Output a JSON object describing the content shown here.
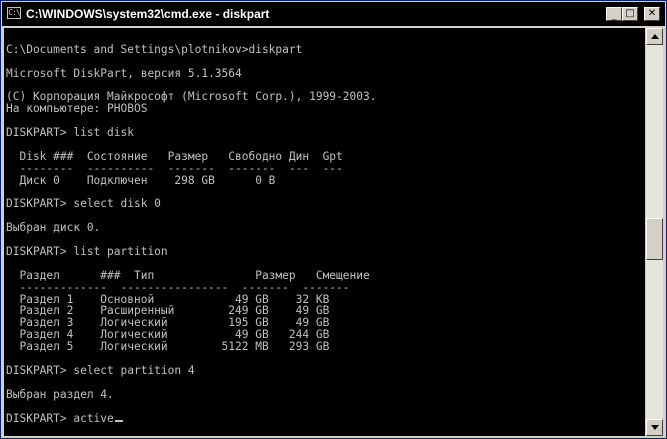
{
  "window": {
    "title": "C:\\WINDOWS\\system32\\cmd.exe - diskpart",
    "icon_label": "C:\\",
    "buttons": {
      "minimize": "_",
      "maximize": "□",
      "close": "✕"
    }
  },
  "console": {
    "lines": [
      "",
      "C:\\Documents and Settings\\plotnikov>diskpart",
      "",
      "Microsoft DiskPart, версия 5.1.3564",
      "",
      "(C) Корпорация Майкрософт (Microsoft Corp.), 1999-2003.",
      "На компьютере: PHOBOS",
      "",
      "DISKPART> list disk",
      "",
      "  Disk ###  Состояние   Размер   Свободно Дин  Gpt",
      "  --------  ----------  -------  -------  ---  ---",
      "  Диск 0    Подключен    298 GB      0 B",
      "",
      "DISKPART> select disk 0",
      "",
      "Выбран диск 0.",
      "",
      "DISKPART> list partition",
      "",
      "  Раздел      ###  Тип               Размер   Смещение",
      "  -------------  ----------------  -------  -------",
      "  Раздел 1    Основной            49 GB    32 KB",
      "  Раздел 2    Расширенный        249 GB    49 GB",
      "  Раздел 3    Логический         195 GB    49 GB",
      "  Раздел 4    Логический          49 GB   244 GB",
      "  Раздел 5    Логический        5122 MB   293 GB",
      "",
      "DISKPART> select partition 4",
      "",
      "Выбран раздел 4.",
      "",
      "DISKPART> active"
    ]
  },
  "colors": {
    "console_bg": "#000000",
    "console_text": "#c0c0c0",
    "titlebar_bg": "#000000",
    "chrome": "#d4d0c8"
  },
  "icons": {
    "app": "console-icon",
    "scroll_up": "arrow-up-icon",
    "scroll_down": "arrow-down-icon"
  }
}
